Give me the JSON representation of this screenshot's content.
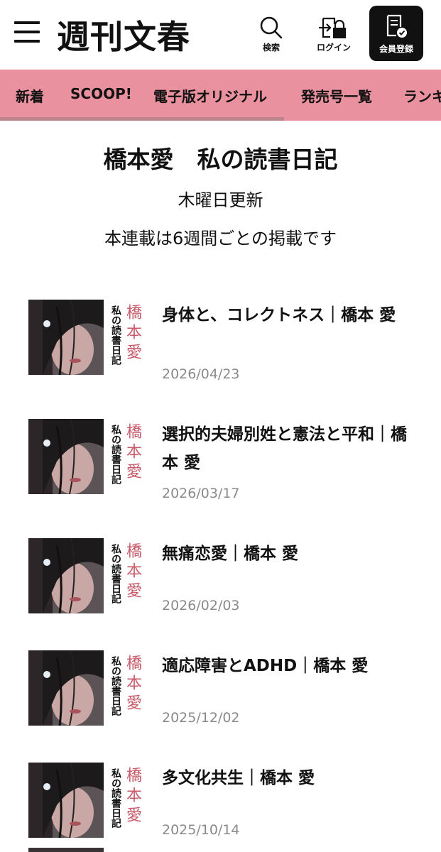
{
  "header": {
    "logo": "週刊文春",
    "search_label": "検索",
    "login_label": "ログイン",
    "member_label": "会員登録"
  },
  "nav": {
    "items": [
      "新着",
      "SCOOP!",
      "電子版オリジナル",
      "発売号一覧",
      "ランキ"
    ]
  },
  "page": {
    "title": "橋本愛　私の読書日記",
    "subtitle": "木曜日更新",
    "note": "本連載は6週間ごとの掲載です"
  },
  "thumbnail": {
    "series_text": "私の読書日記",
    "author_text": "橋本愛"
  },
  "articles": [
    {
      "title": "身体と、コレクトネス｜橋本 愛",
      "date": "2026/04/23"
    },
    {
      "title": "選択的夫婦別姓と憲法と平和｜橋本 愛",
      "date": "2026/03/17"
    },
    {
      "title": "無痛恋愛｜橋本 愛",
      "date": "2026/02/03"
    },
    {
      "title": "適応障害とADHD｜橋本 愛",
      "date": "2025/12/02"
    },
    {
      "title": "多文化共生｜橋本 愛",
      "date": "2025/10/14"
    }
  ],
  "colors": {
    "nav_bg": "#e9919f",
    "author_accent": "#c85a6a",
    "date_gray": "#8a8a8a"
  }
}
